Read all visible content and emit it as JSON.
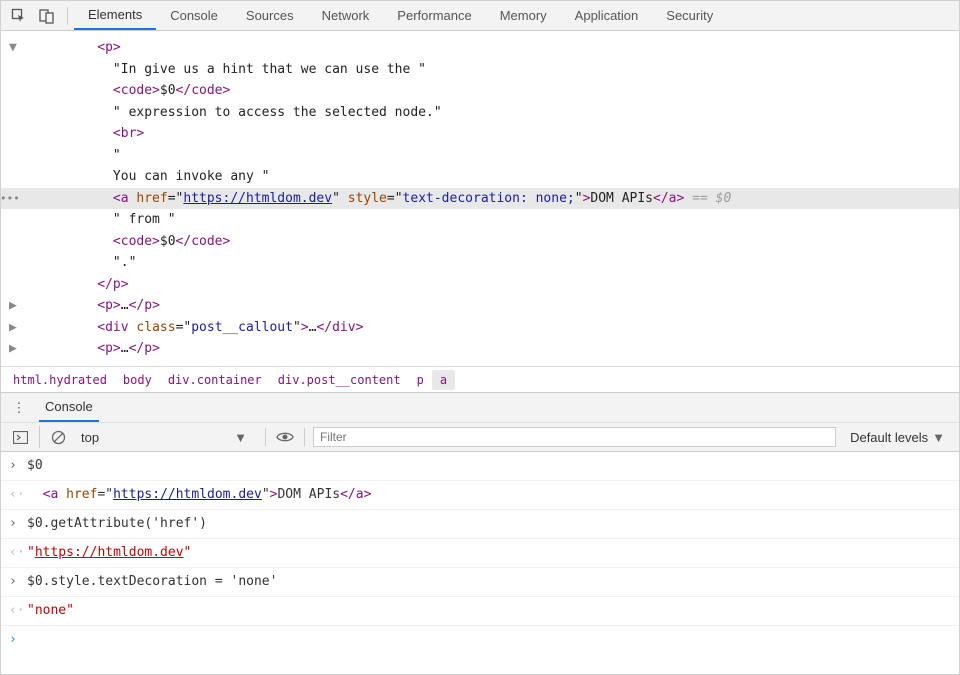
{
  "toolbar": {
    "tabs": [
      "Elements",
      "Console",
      "Sources",
      "Network",
      "Performance",
      "Memory",
      "Application",
      "Security"
    ],
    "active_index": 0
  },
  "tree": {
    "indent0": "          ",
    "indent1": "            ",
    "indent2": "              ",
    "p_open": "<p>",
    "t1": "\"In give us a hint that we can use the \"",
    "code_open": "<code>",
    "dollar0": "$0",
    "code_close": "</code>",
    "t2": "\" expression to access the selected node.\"",
    "br": "<br>",
    "t3a": "\"",
    "t3b": "You can invoke any \"",
    "a_open_tag": "<a",
    "href_attr": " href",
    "eq": "=",
    "href_val": "https://htmldom.dev",
    "style_attr": " style",
    "style_val": "text-decoration: none;",
    "gt": ">",
    "a_text": "DOM APIs",
    "a_close": "</a>",
    "sel_indicator": " == $0",
    "t4": "\" from \"",
    "t5": "\".\"",
    "p_close": "</p>",
    "p_collapsed_open": "<p>",
    "ellipsis": "…",
    "p_collapsed_close": "</p>",
    "div_open": "<div",
    "class_attr": " class",
    "div_class_val": "post__callout",
    "div_close": "</div>"
  },
  "breadcrumbs": [
    "html.hydrated",
    "body",
    "div.container",
    "div.post__content",
    "p",
    "a"
  ],
  "drawer": {
    "tab": "Console"
  },
  "console_toolbar": {
    "context": "top",
    "filter_placeholder": "Filter",
    "levels_label": "Default levels"
  },
  "console": {
    "r1": "$0",
    "r2_pre": "  ",
    "r2_a_open": "<a",
    "r2_href_attr": " href",
    "r2_eq": "=",
    "r2_href_val": "https://htmldom.dev",
    "r2_gt": ">",
    "r2_text": "DOM APIs",
    "r2_a_close": "</a>",
    "r3": "$0.getAttribute('href')",
    "r4_q1": "\"",
    "r4_url": "https://htmldom.dev",
    "r4_q2": "\"",
    "r5": "$0.style.textDecoration = 'none'",
    "r6_q1": "\"",
    "r6_val": "none",
    "r6_q2": "\""
  }
}
